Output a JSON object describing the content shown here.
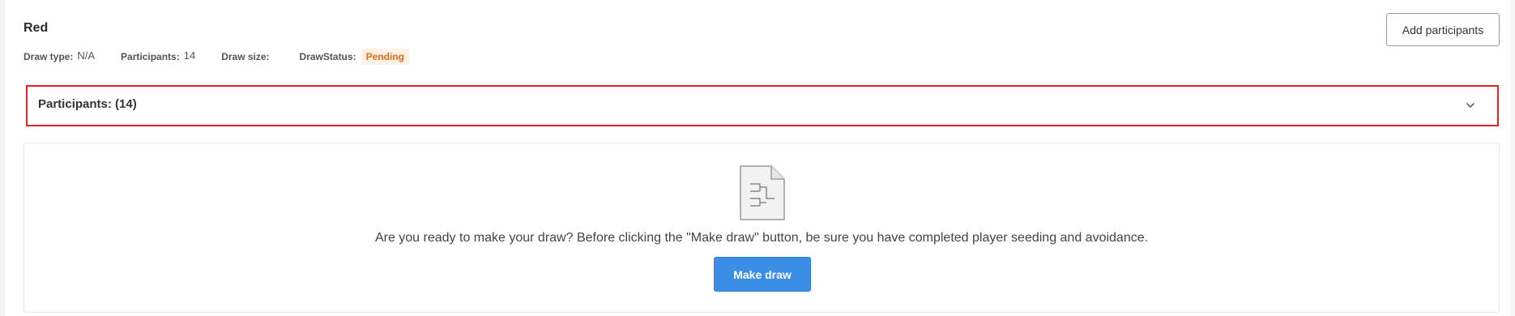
{
  "header": {
    "title": "Red",
    "add_participants_label": "Add participants"
  },
  "meta": {
    "draw_type_label": "Draw type:",
    "draw_type_value": "N/A",
    "participants_label": "Participants:",
    "participants_value": "14",
    "draw_size_label": "Draw size:",
    "draw_size_value": "",
    "draw_status_label": "DrawStatus:",
    "draw_status_value": "Pending"
  },
  "participants_panel": {
    "title": "Participants: (14)",
    "icon": "chevron-down-icon"
  },
  "draw_card": {
    "icon": "bracket-document-icon",
    "message": "Are you ready to make your draw? Before clicking the \"Make draw\" button, be sure you have completed player seeding and avoidance.",
    "make_draw_label": "Make draw"
  },
  "colors": {
    "accent": "#3a8ee6",
    "status_pending_text": "#e26a1c",
    "status_pending_bg": "#fdf1e4",
    "highlight_border": "#e02424"
  }
}
